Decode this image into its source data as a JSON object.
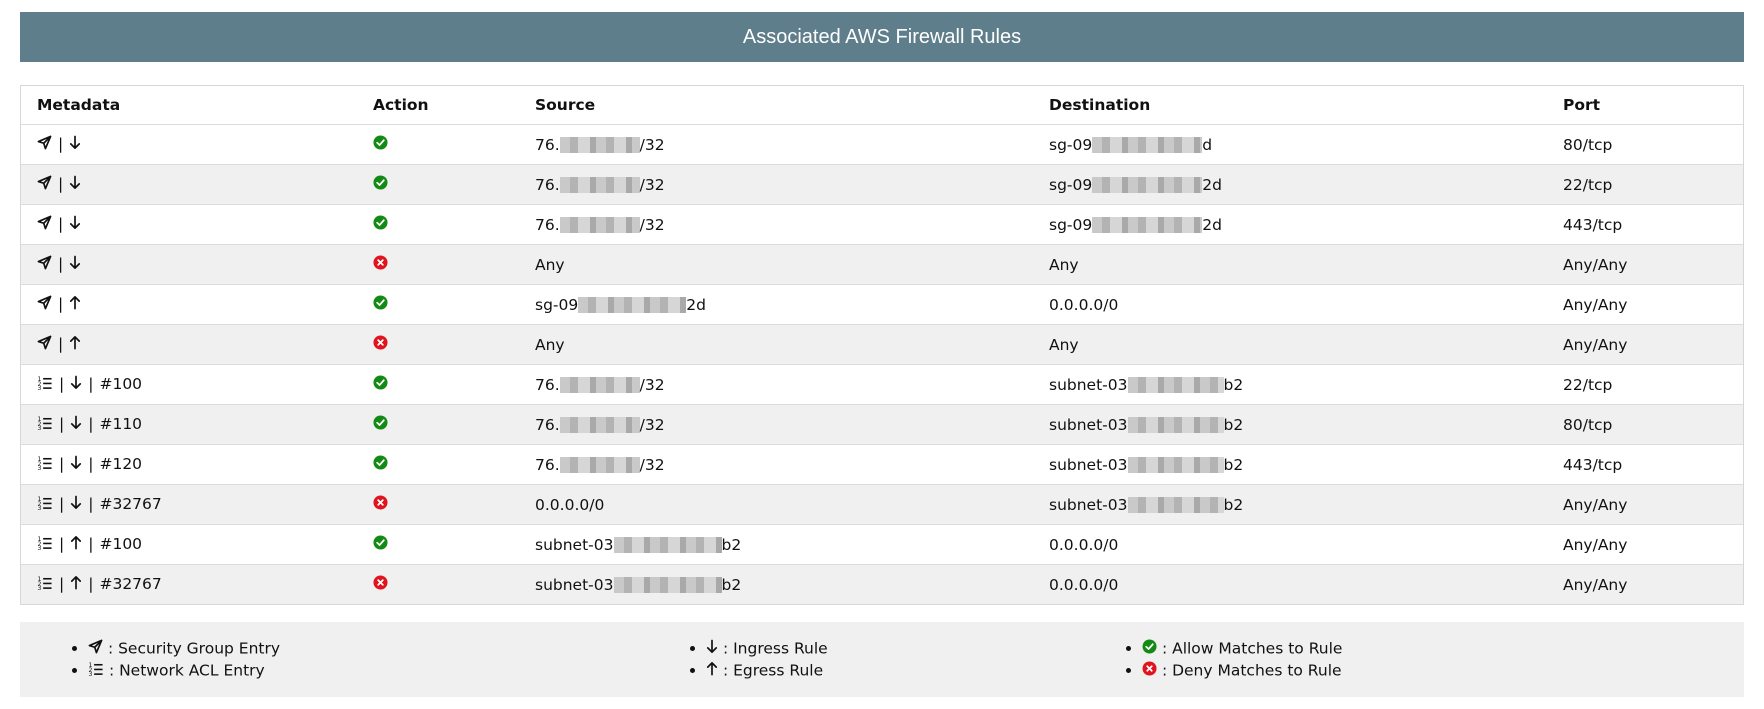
{
  "title": "Associated AWS Firewall Rules",
  "columns": [
    "Metadata",
    "Action",
    "Source",
    "Destination",
    "Port"
  ],
  "rows": [
    {
      "type": "sg",
      "dir": "down",
      "num": "",
      "action": "allow",
      "src_pre": "76.",
      "src_suf": "/32",
      "src_red": true,
      "dst_pre": "sg-09",
      "dst_suf": "d",
      "dst_red": true,
      "port": "80/tcp"
    },
    {
      "type": "sg",
      "dir": "down",
      "num": "",
      "action": "allow",
      "src_pre": "76.",
      "src_suf": "/32",
      "src_red": true,
      "dst_pre": "sg-09",
      "dst_suf": "2d",
      "dst_red": true,
      "port": "22/tcp"
    },
    {
      "type": "sg",
      "dir": "down",
      "num": "",
      "action": "allow",
      "src_pre": "76.",
      "src_suf": "/32",
      "src_red": true,
      "dst_pre": "sg-09",
      "dst_suf": "2d",
      "dst_red": true,
      "port": "443/tcp"
    },
    {
      "type": "sg",
      "dir": "down",
      "num": "",
      "action": "deny",
      "src_pre": "Any",
      "src_suf": "",
      "src_red": false,
      "dst_pre": "Any",
      "dst_suf": "",
      "dst_red": false,
      "port": "Any/Any"
    },
    {
      "type": "sg",
      "dir": "up",
      "num": "",
      "action": "allow",
      "src_pre": "sg-09",
      "src_suf": "2d",
      "src_red": true,
      "dst_pre": "0.0.0.0/0",
      "dst_suf": "",
      "dst_red": false,
      "port": "Any/Any"
    },
    {
      "type": "sg",
      "dir": "up",
      "num": "",
      "action": "deny",
      "src_pre": "Any",
      "src_suf": "",
      "src_red": false,
      "dst_pre": "Any",
      "dst_suf": "",
      "dst_red": false,
      "port": "Any/Any"
    },
    {
      "type": "acl",
      "dir": "down",
      "num": "#100",
      "action": "allow",
      "src_pre": "76.",
      "src_suf": "/32",
      "src_red": true,
      "dst_pre": "subnet-03",
      "dst_suf": "b2",
      "dst_red": true,
      "port": "22/tcp"
    },
    {
      "type": "acl",
      "dir": "down",
      "num": "#110",
      "action": "allow",
      "src_pre": "76.",
      "src_suf": "/32",
      "src_red": true,
      "dst_pre": "subnet-03",
      "dst_suf": "b2",
      "dst_red": true,
      "port": "80/tcp"
    },
    {
      "type": "acl",
      "dir": "down",
      "num": "#120",
      "action": "allow",
      "src_pre": "76.",
      "src_suf": "/32",
      "src_red": true,
      "dst_pre": "subnet-03",
      "dst_suf": "b2",
      "dst_red": true,
      "port": "443/tcp"
    },
    {
      "type": "acl",
      "dir": "down",
      "num": "#32767",
      "action": "deny",
      "src_pre": "0.0.0.0/0",
      "src_suf": "",
      "src_red": false,
      "dst_pre": "subnet-03",
      "dst_suf": "b2",
      "dst_red": true,
      "port": "Any/Any"
    },
    {
      "type": "acl",
      "dir": "up",
      "num": "#100",
      "action": "allow",
      "src_pre": "subnet-03",
      "src_suf": "b2",
      "src_red": true,
      "dst_pre": "0.0.0.0/0",
      "dst_suf": "",
      "dst_red": false,
      "port": "Any/Any"
    },
    {
      "type": "acl",
      "dir": "up",
      "num": "#32767",
      "action": "deny",
      "src_pre": "subnet-03",
      "src_suf": "b2",
      "src_red": true,
      "dst_pre": "0.0.0.0/0",
      "dst_suf": "",
      "dst_red": false,
      "port": "Any/Any"
    }
  ],
  "legend": {
    "security_group": ": Security Group Entry",
    "network_acl": ": Network ACL Entry",
    "ingress": ": Ingress Rule",
    "egress": ": Egress Rule",
    "allow": ": Allow Matches to Rule",
    "deny": ": Deny Matches to Rule"
  },
  "icons": {
    "sg": "send-icon",
    "acl": "numbered-list-icon",
    "down": "arrow-down-icon",
    "up": "arrow-up-icon",
    "allow": "check-circle-icon",
    "deny": "x-circle-icon"
  },
  "colors": {
    "banner": "#5f7e8b",
    "allow": "#138a13",
    "deny": "#e0141e",
    "row_alt": "#f0f0f0"
  }
}
